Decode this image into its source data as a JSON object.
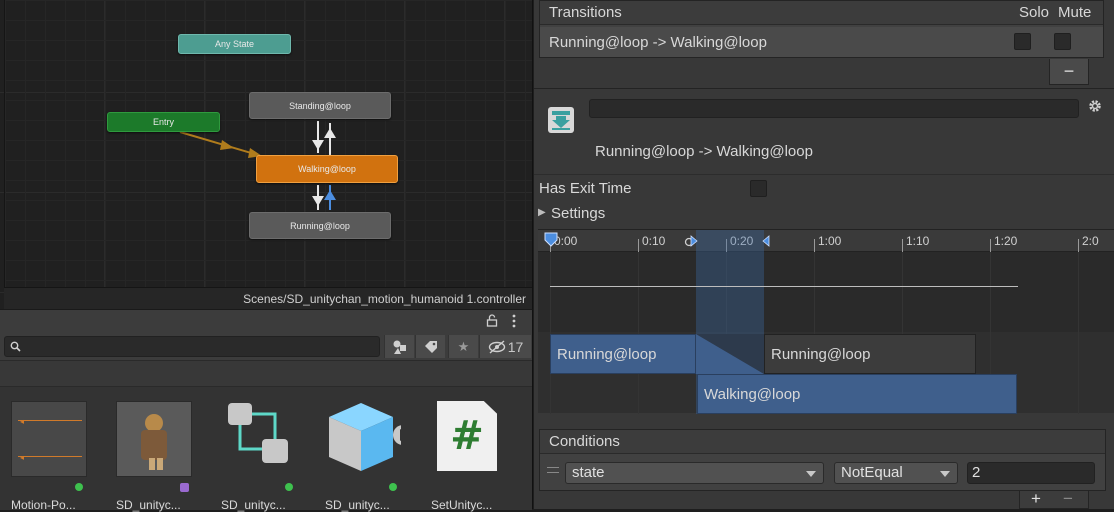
{
  "graph": {
    "nodes": {
      "any_state": "Any State",
      "entry": "Entry",
      "standing": "Standing@loop",
      "walking": "Walking@loop",
      "running": "Running@loop"
    },
    "path": "Scenes/SD_unitychan_motion_humanoid 1.controller"
  },
  "project": {
    "hidden_count": "17",
    "assets": [
      {
        "label": "Motion-Po...",
        "icon": "motion-polish-icon"
      },
      {
        "label": "SD_unityc...",
        "icon": "character-model-icon"
      },
      {
        "label": "SD_unityc...",
        "icon": "animator-controller-icon"
      },
      {
        "label": "SD_unityc...",
        "icon": "prefab-icon"
      },
      {
        "label": "SetUnityc...",
        "icon": "csharp-script-icon"
      }
    ]
  },
  "inspector": {
    "transitions_label": "Transitions",
    "solo_label": "Solo",
    "mute_label": "Mute",
    "transition_row": "Running@loop -> Walking@loop",
    "minus_label": "−",
    "transition_title": "Running@loop -> Walking@loop",
    "has_exit_time_label": "Has Exit Time",
    "settings_label": "Settings",
    "timeline": {
      "ticks": [
        "0:00",
        "0:10",
        "0:20",
        "1:00",
        "1:10",
        "1:20",
        "2:0"
      ],
      "clip_source_a": "Running@loop",
      "clip_source_b": "Running@loop",
      "clip_target": "Walking@loop"
    },
    "conditions": {
      "label": "Conditions",
      "parameter": "state",
      "mode": "NotEqual",
      "value": "2",
      "plus_label": "+",
      "minus_label": "−"
    }
  },
  "colors": {
    "accent_orange": "#d1720f",
    "entry_green": "#1c7a2a",
    "any_state_teal": "#4d9d91",
    "clip_blue": "#3f5f8c"
  }
}
